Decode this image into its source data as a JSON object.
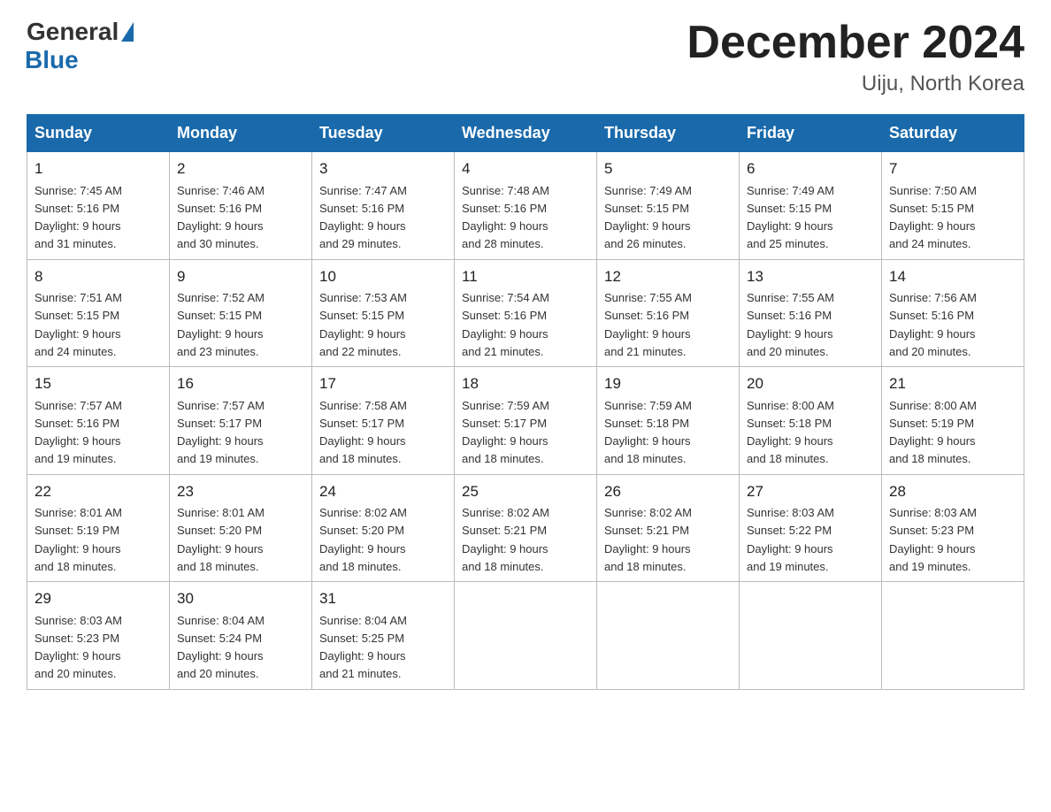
{
  "logo": {
    "general": "General",
    "blue": "Blue"
  },
  "title": "December 2024",
  "subtitle": "Uiju, North Korea",
  "days_of_week": [
    "Sunday",
    "Monday",
    "Tuesday",
    "Wednesday",
    "Thursday",
    "Friday",
    "Saturday"
  ],
  "weeks": [
    [
      {
        "day": "1",
        "sunrise": "7:45 AM",
        "sunset": "5:16 PM",
        "daylight": "9 hours and 31 minutes."
      },
      {
        "day": "2",
        "sunrise": "7:46 AM",
        "sunset": "5:16 PM",
        "daylight": "9 hours and 30 minutes."
      },
      {
        "day": "3",
        "sunrise": "7:47 AM",
        "sunset": "5:16 PM",
        "daylight": "9 hours and 29 minutes."
      },
      {
        "day": "4",
        "sunrise": "7:48 AM",
        "sunset": "5:16 PM",
        "daylight": "9 hours and 28 minutes."
      },
      {
        "day": "5",
        "sunrise": "7:49 AM",
        "sunset": "5:15 PM",
        "daylight": "9 hours and 26 minutes."
      },
      {
        "day": "6",
        "sunrise": "7:49 AM",
        "sunset": "5:15 PM",
        "daylight": "9 hours and 25 minutes."
      },
      {
        "day": "7",
        "sunrise": "7:50 AM",
        "sunset": "5:15 PM",
        "daylight": "9 hours and 24 minutes."
      }
    ],
    [
      {
        "day": "8",
        "sunrise": "7:51 AM",
        "sunset": "5:15 PM",
        "daylight": "9 hours and 24 minutes."
      },
      {
        "day": "9",
        "sunrise": "7:52 AM",
        "sunset": "5:15 PM",
        "daylight": "9 hours and 23 minutes."
      },
      {
        "day": "10",
        "sunrise": "7:53 AM",
        "sunset": "5:15 PM",
        "daylight": "9 hours and 22 minutes."
      },
      {
        "day": "11",
        "sunrise": "7:54 AM",
        "sunset": "5:16 PM",
        "daylight": "9 hours and 21 minutes."
      },
      {
        "day": "12",
        "sunrise": "7:55 AM",
        "sunset": "5:16 PM",
        "daylight": "9 hours and 21 minutes."
      },
      {
        "day": "13",
        "sunrise": "7:55 AM",
        "sunset": "5:16 PM",
        "daylight": "9 hours and 20 minutes."
      },
      {
        "day": "14",
        "sunrise": "7:56 AM",
        "sunset": "5:16 PM",
        "daylight": "9 hours and 20 minutes."
      }
    ],
    [
      {
        "day": "15",
        "sunrise": "7:57 AM",
        "sunset": "5:16 PM",
        "daylight": "9 hours and 19 minutes."
      },
      {
        "day": "16",
        "sunrise": "7:57 AM",
        "sunset": "5:17 PM",
        "daylight": "9 hours and 19 minutes."
      },
      {
        "day": "17",
        "sunrise": "7:58 AM",
        "sunset": "5:17 PM",
        "daylight": "9 hours and 18 minutes."
      },
      {
        "day": "18",
        "sunrise": "7:59 AM",
        "sunset": "5:17 PM",
        "daylight": "9 hours and 18 minutes."
      },
      {
        "day": "19",
        "sunrise": "7:59 AM",
        "sunset": "5:18 PM",
        "daylight": "9 hours and 18 minutes."
      },
      {
        "day": "20",
        "sunrise": "8:00 AM",
        "sunset": "5:18 PM",
        "daylight": "9 hours and 18 minutes."
      },
      {
        "day": "21",
        "sunrise": "8:00 AM",
        "sunset": "5:19 PM",
        "daylight": "9 hours and 18 minutes."
      }
    ],
    [
      {
        "day": "22",
        "sunrise": "8:01 AM",
        "sunset": "5:19 PM",
        "daylight": "9 hours and 18 minutes."
      },
      {
        "day": "23",
        "sunrise": "8:01 AM",
        "sunset": "5:20 PM",
        "daylight": "9 hours and 18 minutes."
      },
      {
        "day": "24",
        "sunrise": "8:02 AM",
        "sunset": "5:20 PM",
        "daylight": "9 hours and 18 minutes."
      },
      {
        "day": "25",
        "sunrise": "8:02 AM",
        "sunset": "5:21 PM",
        "daylight": "9 hours and 18 minutes."
      },
      {
        "day": "26",
        "sunrise": "8:02 AM",
        "sunset": "5:21 PM",
        "daylight": "9 hours and 18 minutes."
      },
      {
        "day": "27",
        "sunrise": "8:03 AM",
        "sunset": "5:22 PM",
        "daylight": "9 hours and 19 minutes."
      },
      {
        "day": "28",
        "sunrise": "8:03 AM",
        "sunset": "5:23 PM",
        "daylight": "9 hours and 19 minutes."
      }
    ],
    [
      {
        "day": "29",
        "sunrise": "8:03 AM",
        "sunset": "5:23 PM",
        "daylight": "9 hours and 20 minutes."
      },
      {
        "day": "30",
        "sunrise": "8:04 AM",
        "sunset": "5:24 PM",
        "daylight": "9 hours and 20 minutes."
      },
      {
        "day": "31",
        "sunrise": "8:04 AM",
        "sunset": "5:25 PM",
        "daylight": "9 hours and 21 minutes."
      },
      null,
      null,
      null,
      null
    ]
  ],
  "labels": {
    "sunrise": "Sunrise:",
    "sunset": "Sunset:",
    "daylight": "Daylight:"
  }
}
